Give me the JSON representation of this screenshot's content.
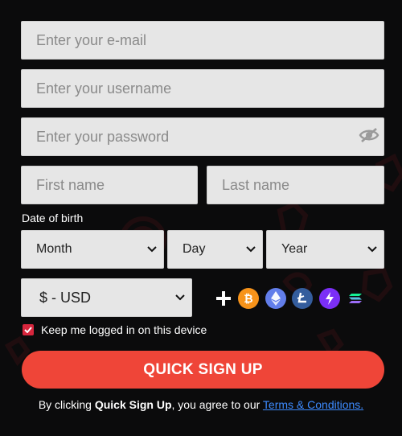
{
  "form": {
    "email_placeholder": "Enter your e-mail",
    "username_placeholder": "Enter your username",
    "password_placeholder": "Enter your password",
    "firstname_placeholder": "First name",
    "lastname_placeholder": "Last name"
  },
  "dob": {
    "label": "Date of birth",
    "month": "Month",
    "day": "Day",
    "year": "Year"
  },
  "currency": {
    "selected": "$ - USD"
  },
  "crypto_icons": [
    "bitcoin-icon",
    "ethereum-icon",
    "litecoin-icon",
    "lightning-icon",
    "solana-icon"
  ],
  "keep_logged": {
    "label": "Keep me logged in on this device",
    "checked": true
  },
  "signup": {
    "button_label": "QUICK SIGN UP"
  },
  "terms": {
    "prefix": "By clicking ",
    "bold": "Quick Sign Up",
    "middle": ", you agree to our ",
    "link": "Terms & Conditions."
  },
  "colors": {
    "background": "#0b0b0c",
    "field": "#e6e6e6",
    "accent_red": "#ef4538",
    "checkbox": "#d7263d",
    "link": "#3d8bff",
    "bitcoin": "#f7931a",
    "ethereum": "#627eea",
    "litecoin": "#345d9d",
    "lightning": "#7b2ff7"
  }
}
